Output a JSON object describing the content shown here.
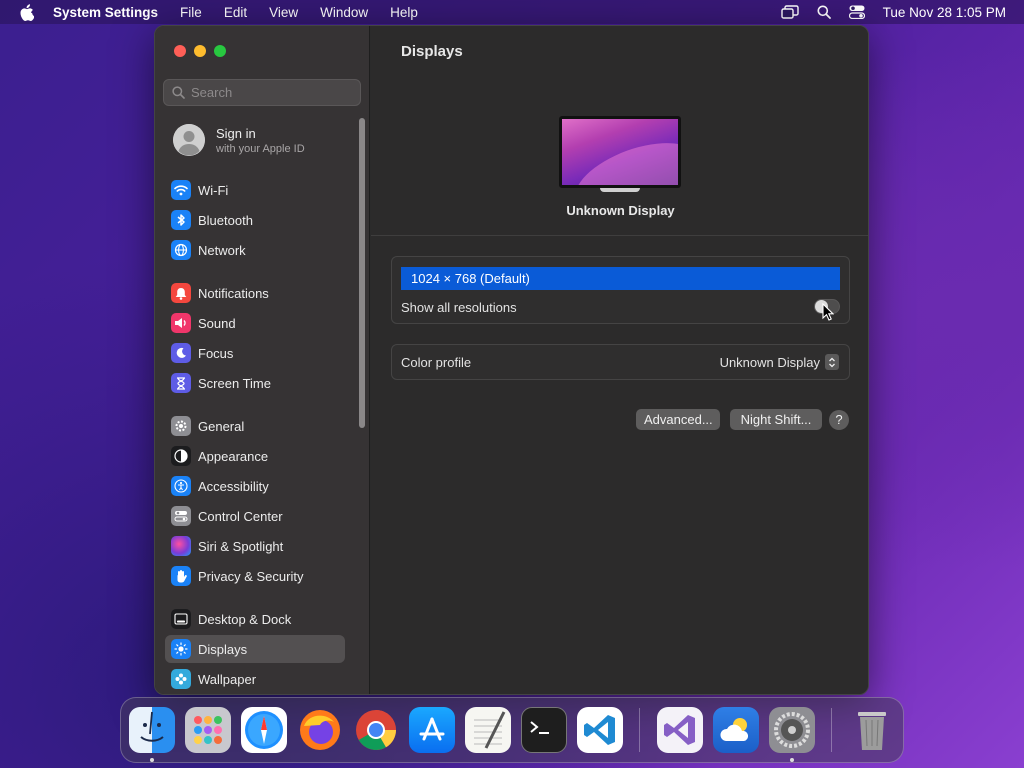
{
  "menubar": {
    "app_name": "System Settings",
    "menus": [
      "File",
      "Edit",
      "View",
      "Window",
      "Help"
    ],
    "datetime": "Tue Nov 28  1:05 PM"
  },
  "window": {
    "search": {
      "placeholder": "Search",
      "value": ""
    },
    "account": {
      "title": "Sign in",
      "subtitle": "with your Apple ID"
    },
    "sidebar": {
      "items": [
        {
          "label": "Wi-Fi",
          "icon": "wifi-icon",
          "color": "#1a82f7"
        },
        {
          "label": "Bluetooth",
          "icon": "bluetooth-icon",
          "color": "#1a82f7"
        },
        {
          "label": "Network",
          "icon": "globe-icon",
          "color": "#1a82f7"
        },
        {
          "label": "Notifications",
          "icon": "bell-icon",
          "color": "#f4473e"
        },
        {
          "label": "Sound",
          "icon": "speaker-icon",
          "color": "#f0366a"
        },
        {
          "label": "Focus",
          "icon": "moon-icon",
          "color": "#5e5ce6"
        },
        {
          "label": "Screen Time",
          "icon": "hourglass-icon",
          "color": "#5e5ce6"
        },
        {
          "label": "General",
          "icon": "gear-icon",
          "color": "#8e8e93"
        },
        {
          "label": "Appearance",
          "icon": "appearance-icon",
          "color": "#1c1c1e"
        },
        {
          "label": "Accessibility",
          "icon": "accessibility-icon",
          "color": "#1a82f7"
        },
        {
          "label": "Control Center",
          "icon": "control-center-icon",
          "color": "#8e8e93"
        },
        {
          "label": "Siri & Spotlight",
          "icon": "siri-icon",
          "color": "#7a3cd6"
        },
        {
          "label": "Privacy & Security",
          "icon": "hand-icon",
          "color": "#1a82f7"
        },
        {
          "label": "Desktop & Dock",
          "icon": "dock-icon",
          "color": "#1c1c1e"
        },
        {
          "label": "Displays",
          "icon": "sun-icon",
          "color": "#1a82f7",
          "selected": true
        },
        {
          "label": "Wallpaper",
          "icon": "wallpaper-icon",
          "color": "#34aadc"
        }
      ]
    },
    "main": {
      "title": "Displays",
      "display_name": "Unknown Display",
      "resolution_selected": "1024 × 768 (Default)",
      "show_all_label": "Show all resolutions",
      "show_all_on": false,
      "color_profile_label": "Color profile",
      "color_profile_value": "Unknown Display",
      "advanced_label": "Advanced...",
      "night_shift_label": "Night Shift...",
      "help_label": "?"
    }
  },
  "dock": {
    "apps": [
      "Finder",
      "Launchpad",
      "Safari",
      "Firefox",
      "Chrome",
      "App Store",
      "TextEdit",
      "Terminal",
      "Visual Studio Code",
      "Visual Studio",
      "Weather",
      "System Settings",
      "Trash"
    ]
  }
}
